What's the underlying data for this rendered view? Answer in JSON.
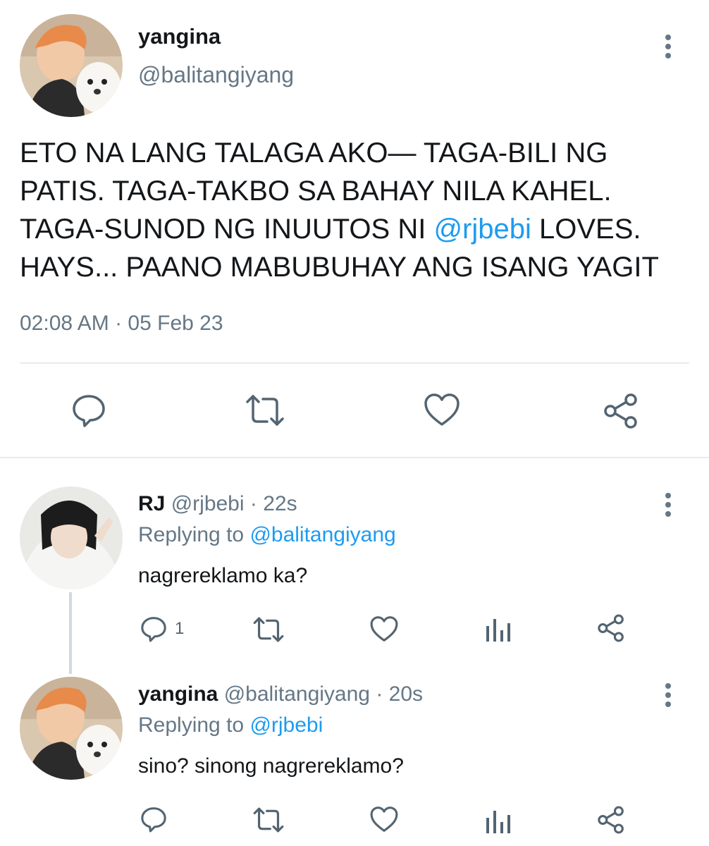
{
  "main_tweet": {
    "display_name": "yangina",
    "handle": "@balitangiyang",
    "text_before": "ETO NA LANG TALAGA AKO— TAGA-BILI NG PATIS. TAGA-TAKBO SA BAHAY NILA KAHEL. TAGA-SUNOD NG INUUTOS NI ",
    "mention": "@rjbebi",
    "text_after": " LOVES. HAYS... PAANO MABUBUHAY ANG ISANG YAGIT",
    "timestamp": "02:08 AM · 05 Feb 23",
    "actions": [
      "reply-icon",
      "retweet-icon",
      "like-icon",
      "share-icon"
    ]
  },
  "replies": [
    {
      "display_name": "RJ",
      "handle": "@rjbebi",
      "time": "· 22s",
      "replying_to_label": "Replying to",
      "replying_to": "@balitangiyang",
      "text": "nagrereklamo ka?",
      "reply_count": "1",
      "actions": [
        "reply-icon",
        "retweet-icon",
        "like-icon",
        "analytics-icon",
        "share-icon"
      ]
    },
    {
      "display_name": "yangina",
      "handle": "@balitangiyang",
      "time": "· 20s",
      "replying_to_label": "Replying to",
      "replying_to": "@rjbebi",
      "text": "sino? sinong nagrereklamo?",
      "reply_count": "",
      "actions": [
        "reply-icon",
        "retweet-icon",
        "like-icon",
        "analytics-icon",
        "share-icon"
      ]
    }
  ],
  "colors": {
    "accent": "#1d9bf0",
    "muted": "#657786",
    "divider": "#e6ecf0"
  }
}
